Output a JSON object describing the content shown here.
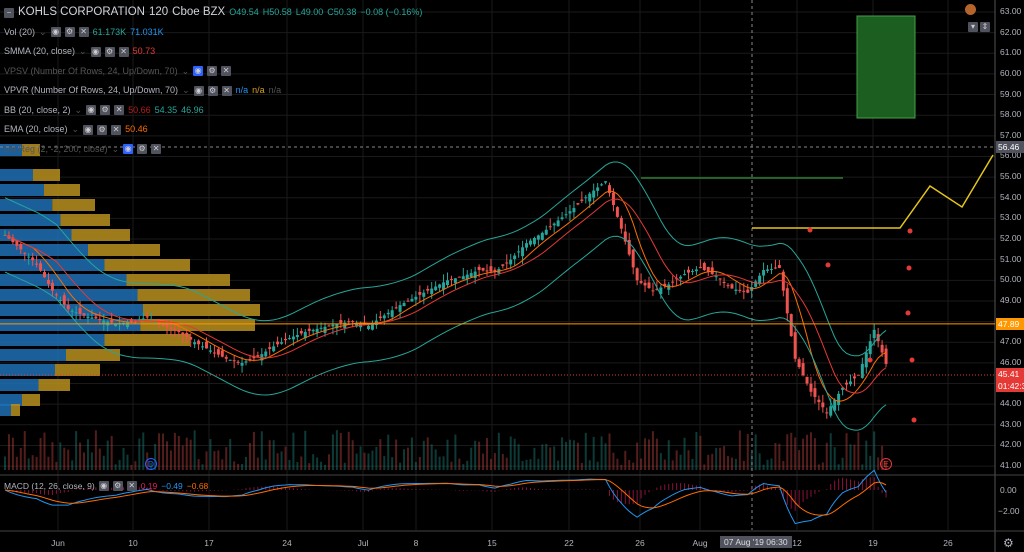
{
  "header": {
    "symbol": "KOHLS CORPORATION",
    "interval": "120",
    "exchange": "Cboe BZX",
    "open": "O49.54",
    "high": "H50.58",
    "low": "L49.00",
    "close": "C50.38",
    "change": "−0.08 (−0.16%)"
  },
  "indicators": [
    {
      "name": "Vol (20)",
      "values": [
        "61.173K",
        "71.031K"
      ],
      "colors": [
        "#26a69a",
        "#2196f3"
      ]
    },
    {
      "name": "SMMA (20, close)",
      "values": [
        "50.73"
      ],
      "colors": [
        "#e53935"
      ]
    },
    {
      "name": "VPSV (Number Of Rows, 24, Up/Down, 70)",
      "values": [],
      "colors": [],
      "dim": true
    },
    {
      "name": "VPVR (Number Of Rows, 24, Up/Down, 70)",
      "values": [
        "n/a",
        "n/a",
        "n/a"
      ],
      "colors": [
        "#2196f3",
        "#d4a017",
        "#555"
      ]
    },
    {
      "name": "BB (20, close, 2)",
      "values": [
        "50.66",
        "54.35",
        "46.96"
      ],
      "colors": [
        "#b71c1c",
        "#26a69a",
        "#26a69a"
      ]
    },
    {
      "name": "EMA (20, close)",
      "values": [
        "50.46"
      ],
      "colors": [
        "#ff6d00"
      ]
    },
    {
      "name": "Lin Reg (2, -2, 200, close)",
      "values": [],
      "colors": [],
      "dim": true
    }
  ],
  "macd": {
    "name": "MACD (12, 26, close, 9)",
    "values": [
      "0.19",
      "−0.49",
      "−0.68"
    ],
    "colors": [
      "#e91e63",
      "#2196f3",
      "#ff6d00"
    ],
    "axis": [
      "0.00",
      "−2.00"
    ]
  },
  "price_axis": [
    "63.00",
    "62.00",
    "61.00",
    "60.00",
    "59.00",
    "58.00",
    "57.00",
    "56.00",
    "55.00",
    "54.00",
    "53.00",
    "52.00",
    "51.00",
    "50.00",
    "49.00",
    "47.00",
    "46.00",
    "44.00",
    "43.00",
    "42.00",
    "41.00"
  ],
  "price_tags": {
    "crosshair": "56.46",
    "line": "47.89",
    "last": "45.41",
    "countdown": "01:42:3"
  },
  "time_axis": [
    "Jun",
    "10",
    "17",
    "24",
    "Jul",
    "8",
    "15",
    "22",
    "26",
    "Aug",
    "12",
    "19",
    "26"
  ],
  "crosshair_date": "07 Aug '19  06:30",
  "markers": {
    "dividend": "D",
    "earnings": "E"
  },
  "colors": {
    "up": "#26a69a",
    "down": "#ef5350",
    "bg": "#000000",
    "forecast": "#e6c619",
    "target_box": "#1b5e20"
  },
  "chart_data": {
    "type": "candlestick",
    "price_path": [
      52.2,
      51.5,
      50.8,
      49.5,
      48.6,
      48.3,
      48.1,
      47.9,
      48.0,
      48.2,
      47.8,
      47.5,
      47.0,
      46.6,
      46.2,
      46.0,
      46.3,
      46.8,
      47.2,
      47.5,
      47.7,
      47.9,
      48.0,
      47.8,
      48.3,
      48.8,
      49.2,
      49.6,
      50.0,
      50.2,
      50.5,
      50.4,
      51.0,
      51.8,
      52.3,
      52.9,
      53.5,
      54.2,
      54.8,
      52.5,
      50.0,
      49.5,
      49.8,
      50.3,
      50.6,
      50.2,
      49.6,
      49.4,
      50.5,
      50.6,
      46.2,
      44.6,
      43.6,
      44.8,
      45.4,
      47.6,
      45.4
    ],
    "ylim": [
      41,
      63
    ]
  }
}
